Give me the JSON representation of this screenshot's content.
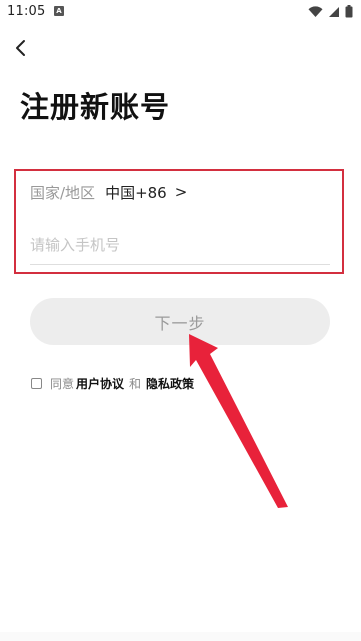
{
  "status_bar": {
    "time": "11:05",
    "badge": "A"
  },
  "nav": {
    "back_icon": "chevron-left-icon"
  },
  "page": {
    "title": "注册新账号"
  },
  "form": {
    "region_label": "国家/地区",
    "region_value": "中国+86",
    "region_chevron": ">",
    "phone_placeholder": "请输入手机号",
    "phone_value": ""
  },
  "actions": {
    "next_label": "下一步",
    "next_enabled": false
  },
  "agreement": {
    "checked": false,
    "prefix": "同意",
    "user_agreement": "用户协议",
    "and": "和",
    "privacy_policy": "隐私政策"
  },
  "annotation": {
    "highlight_color": "#d32f3f",
    "arrow_color": "#e8223a"
  }
}
